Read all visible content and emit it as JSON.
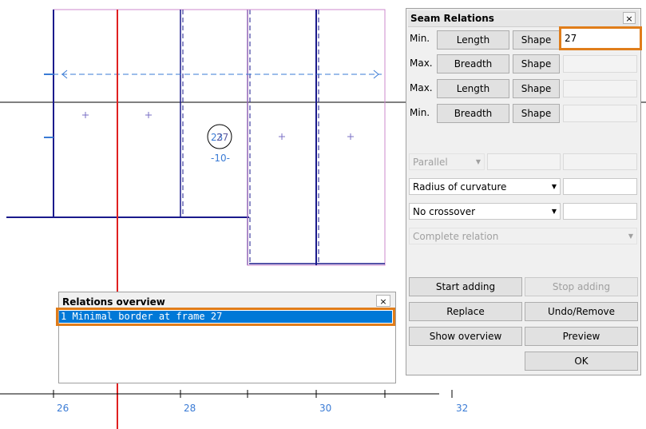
{
  "drawing": {
    "frame_label_circle": "27",
    "frame_label_small": "23",
    "dim_label": "-10-",
    "axis_ticks": [
      "26",
      "28",
      "30",
      "32"
    ]
  },
  "seam_panel": {
    "title": "Seam Relations",
    "close": "×",
    "rows": [
      {
        "prefix": "Min.",
        "button": "Length",
        "shape": "Shape",
        "value": "27"
      },
      {
        "prefix": "Max.",
        "button": "Breadth",
        "shape": "Shape",
        "value": ""
      },
      {
        "prefix": "Max.",
        "button": "Length",
        "shape": "Shape",
        "value": ""
      },
      {
        "prefix": "Min.",
        "button": "Breadth",
        "shape": "Shape",
        "value": ""
      }
    ],
    "parallel_select": "Parallel",
    "radius_select": "Radius of curvature",
    "crossover_select": "No crossover",
    "complete_select": "Complete relation",
    "buttons": {
      "start_adding": "Start adding",
      "stop_adding": "Stop adding",
      "replace": "Replace",
      "undo_remove": "Undo/Remove",
      "show_overview": "Show overview",
      "preview": "Preview",
      "ok": "OK"
    }
  },
  "overview": {
    "title": "Relations overview",
    "close": "×",
    "items": [
      "1 Minimal border at frame 27"
    ]
  }
}
